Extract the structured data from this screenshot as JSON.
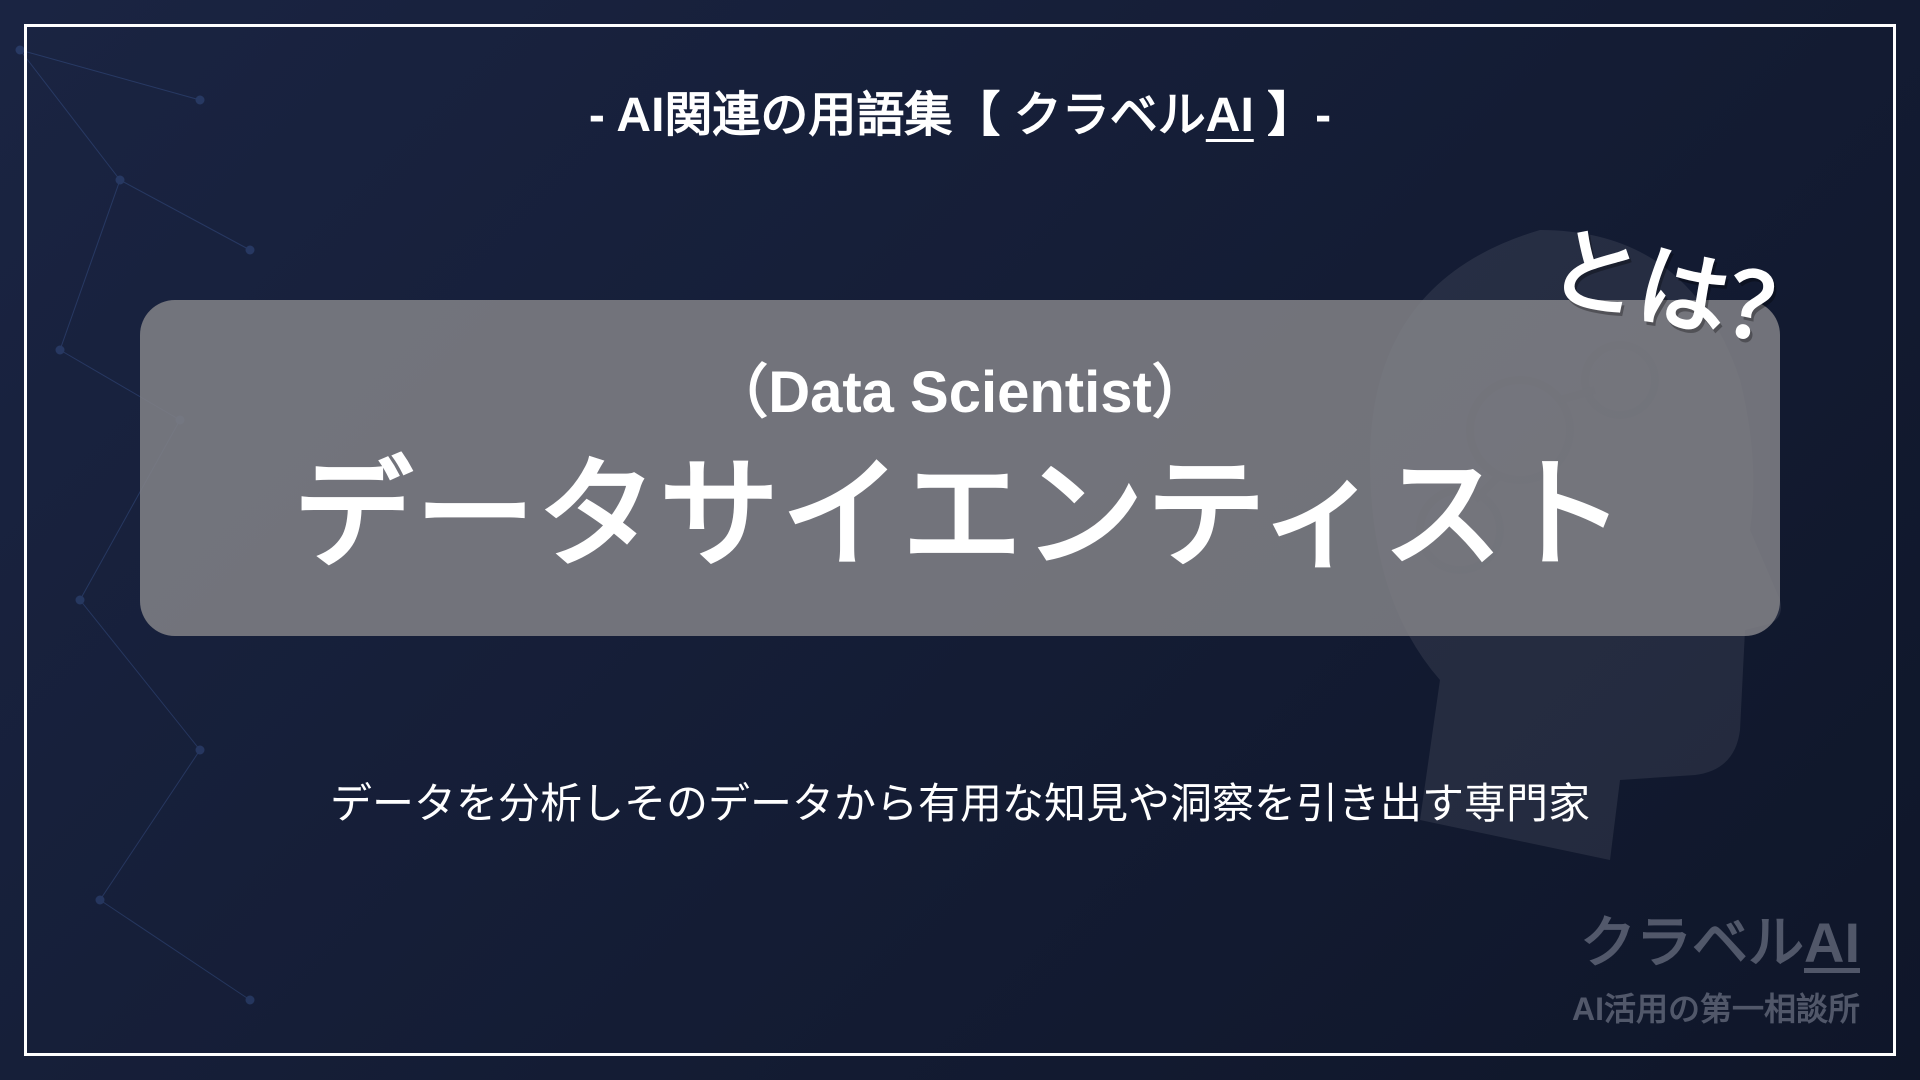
{
  "header": {
    "prefix": "- AI関連の用語集【 クラベル",
    "ai_text": "AI",
    "suffix": " 】-"
  },
  "card": {
    "english_term": "（Data Scientist）",
    "japanese_term": "データサイエンティスト",
    "question_marker": "とは？"
  },
  "description": "データを分析しそのデータから有用な知見や洞察を引き出す専門家",
  "brand": {
    "name_prefix": "クラベル",
    "ai_text": "AI",
    "tagline": "AI活用の第一相談所"
  }
}
